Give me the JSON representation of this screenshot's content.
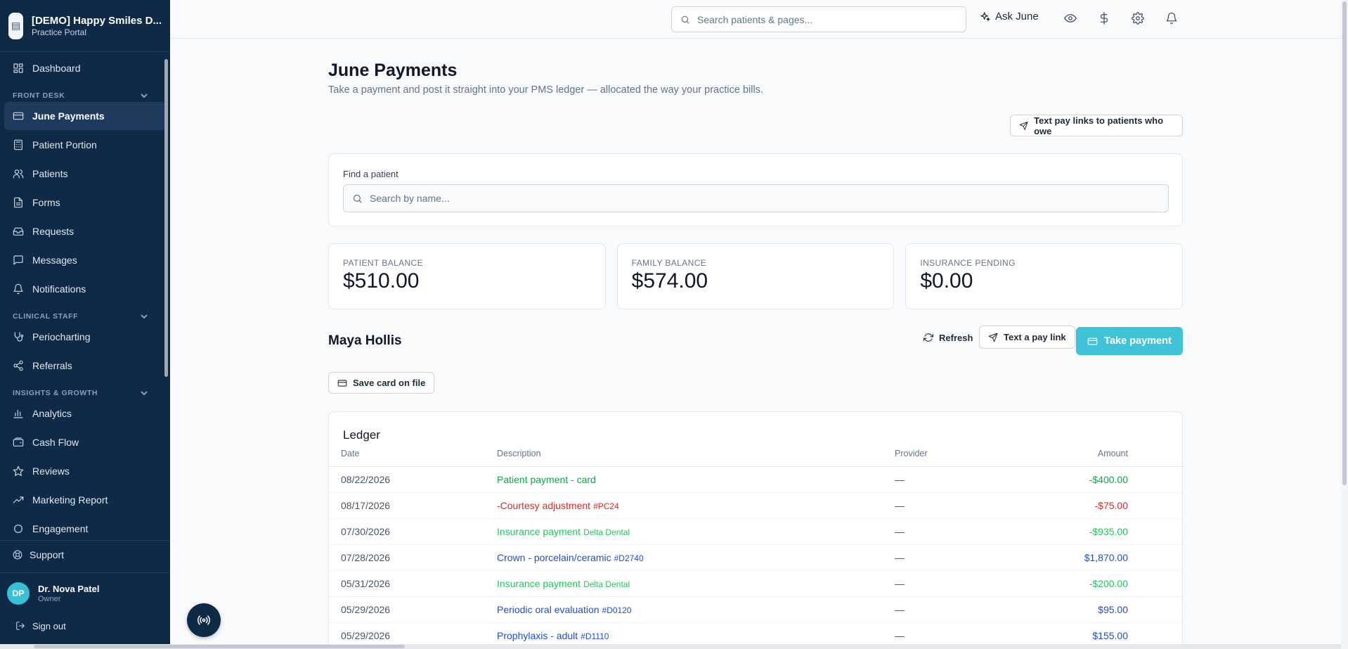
{
  "brand": {
    "name": "[DEMO] Happy Smiles D...",
    "subtitle": "Practice Portal"
  },
  "sidebar": {
    "top_items": [
      {
        "label": "Dashboard",
        "icon": "dashboard-icon"
      }
    ],
    "sections": [
      {
        "label": "FRONT DESK",
        "items": [
          {
            "label": "June Payments",
            "icon": "card-icon",
            "active": true
          },
          {
            "label": "Patient Portion",
            "icon": "calculator-icon"
          },
          {
            "label": "Patients",
            "icon": "users-icon"
          },
          {
            "label": "Forms",
            "icon": "file-icon"
          },
          {
            "label": "Requests",
            "icon": "inbox-icon"
          },
          {
            "label": "Messages",
            "icon": "message-icon"
          },
          {
            "label": "Notifications",
            "icon": "bell-icon"
          }
        ]
      },
      {
        "label": "CLINICAL STAFF",
        "items": [
          {
            "label": "Periocharting",
            "icon": "stethoscope-icon"
          },
          {
            "label": "Referrals",
            "icon": "share-icon"
          }
        ]
      },
      {
        "label": "INSIGHTS & GROWTH",
        "items": [
          {
            "label": "Analytics",
            "icon": "bar-chart-icon"
          },
          {
            "label": "Cash Flow",
            "icon": "wallet-icon"
          },
          {
            "label": "Reviews",
            "icon": "star-icon"
          },
          {
            "label": "Marketing Report",
            "icon": "trending-up-icon"
          },
          {
            "label": "Engagement",
            "icon": "engagement-icon"
          }
        ]
      }
    ],
    "support_label": "Support",
    "user": {
      "initials": "DP",
      "name": "Dr. Nova Patel",
      "role": "Owner"
    },
    "signout_label": "Sign out"
  },
  "topbar": {
    "search_placeholder": "Search patients & pages...",
    "ask_label": "Ask June"
  },
  "page": {
    "title": "June Payments",
    "subtitle": "Take a payment and post it straight into your PMS ledger — allocated the way your practice bills.",
    "text_links_button": "Text pay links to patients who owe"
  },
  "find": {
    "label": "Find a patient",
    "placeholder": "Search by name..."
  },
  "stats": [
    {
      "label": "PATIENT BALANCE",
      "value": "$510.00"
    },
    {
      "label": "FAMILY BALANCE",
      "value": "$574.00"
    },
    {
      "label": "INSURANCE PENDING",
      "value": "$0.00"
    }
  ],
  "patient": {
    "name": "Maya Hollis",
    "refresh_label": "Refresh",
    "pay_link_label": "Text a pay link",
    "take_payment_label": "Take payment",
    "save_card_label": "Save card on file"
  },
  "ledger": {
    "title": "Ledger",
    "columns": {
      "date": "Date",
      "description": "Description",
      "provider": "Provider",
      "amount": "Amount"
    },
    "rows": [
      {
        "date": "08/22/2026",
        "description": "Patient payment - card",
        "code": "",
        "provider": "—",
        "amount": "-$400.00",
        "tone": "pay"
      },
      {
        "date": "08/17/2026",
        "description": "-Courtesy adjustment",
        "code": "#PC24",
        "provider": "—",
        "amount": "-$75.00",
        "tone": "adj"
      },
      {
        "date": "07/30/2026",
        "description": "Insurance payment",
        "code": "Delta Dental",
        "provider": "—",
        "amount": "-$935.00",
        "tone": "ins"
      },
      {
        "date": "07/28/2026",
        "description": "Crown - porcelain/ceramic",
        "code": "#D2740",
        "provider": "—",
        "amount": "$1,870.00",
        "tone": "chg"
      },
      {
        "date": "05/31/2026",
        "description": "Insurance payment",
        "code": "Delta Dental",
        "provider": "—",
        "amount": "-$200.00",
        "tone": "ins"
      },
      {
        "date": "05/29/2026",
        "description": "Periodic oral evaluation",
        "code": "#D0120",
        "provider": "—",
        "amount": "$95.00",
        "tone": "chg"
      },
      {
        "date": "05/29/2026",
        "description": "Prophylaxis - adult",
        "code": "#D1110",
        "provider": "—",
        "amount": "$155.00",
        "tone": "chg"
      }
    ]
  },
  "colors": {
    "sidebar_bg": "#0f2a47",
    "accent": "#3ec4d6",
    "payment": "#16a34a",
    "adjustment": "#dc2626",
    "insurance": "#22c55e",
    "charge": "#1d4ed8"
  }
}
